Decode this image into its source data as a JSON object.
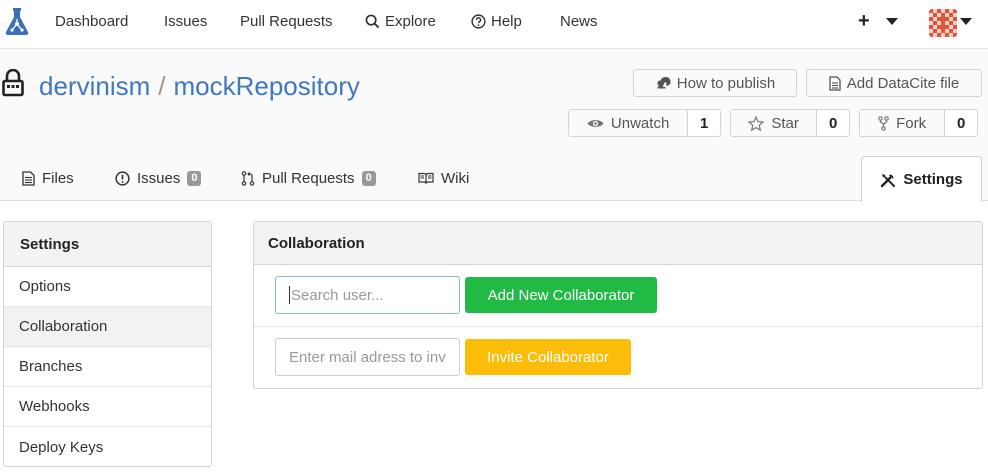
{
  "nav": {
    "items": [
      {
        "label": "Dashboard"
      },
      {
        "label": "Issues"
      },
      {
        "label": "Pull Requests"
      },
      {
        "label": "Explore",
        "icon": "search-icon"
      },
      {
        "label": "Help",
        "icon": "help-icon"
      },
      {
        "label": "News"
      }
    ],
    "plus": "+"
  },
  "repo": {
    "owner": "dervinism",
    "separator": "/",
    "name": "mockRepository",
    "how_to_publish": "How to publish",
    "add_datacite": "Add DataCite file",
    "unwatch": {
      "label": "Unwatch",
      "count": "1"
    },
    "star": {
      "label": "Star",
      "count": "0"
    },
    "fork": {
      "label": "Fork",
      "count": "0"
    }
  },
  "tabs": {
    "files": "Files",
    "issues": {
      "label": "Issues",
      "count": "0"
    },
    "pulls": {
      "label": "Pull Requests",
      "count": "0"
    },
    "wiki": "Wiki",
    "settings": "Settings"
  },
  "sidebar": {
    "title": "Settings",
    "items": [
      {
        "label": "Options"
      },
      {
        "label": "Collaboration"
      },
      {
        "label": "Branches"
      },
      {
        "label": "Webhooks"
      },
      {
        "label": "Deploy Keys"
      }
    ],
    "active": "Collaboration"
  },
  "collaboration": {
    "title": "Collaboration",
    "search_placeholder": "Search user...",
    "add_button": "Add New Collaborator",
    "mail_placeholder": "Enter mail adress to inv",
    "invite_button": "Invite Collaborator"
  },
  "colors": {
    "link": "#4078c0",
    "green": "#21ba45",
    "yellow": "#fbbd08"
  }
}
